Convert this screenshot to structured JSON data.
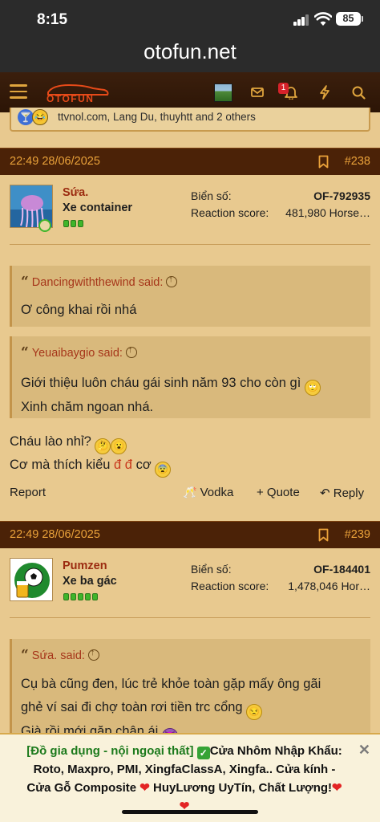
{
  "status": {
    "time": "8:15",
    "battery": "85"
  },
  "browser": {
    "url": "otofun.net"
  },
  "nav": {
    "logo_text": "OTOFUN",
    "notification_count": "1"
  },
  "reactions_strip": {
    "text": "ttvnol.com, Lang Du, thuyhtt and 2 others"
  },
  "posts": [
    {
      "datetime": "22:49 28/06/2025",
      "number": "#238",
      "username": "Sứa.",
      "user_title": "Xe container",
      "plate_label": "Biển số:",
      "plate_value": "OF-792935",
      "reaction_label": "Reaction score:",
      "reaction_value": "481,980 Horse…",
      "quotes": [
        {
          "author": "Dancingwiththewind said:",
          "body": "Ơ công khai rồi nhá"
        },
        {
          "author": "Yeuaibaygio said:",
          "body_line1": "Giới thiệu luôn cháu gái sinh năm 93 cho còn gì",
          "body_line2": "Xinh chăm ngoan nhá."
        }
      ],
      "text_line1": "Cháu lào nhỉ?",
      "text_line2_a": "Cơ mà thích kiểu",
      "text_line2_red": "đ đ",
      "text_line2_b": "cơ",
      "actions": {
        "report": "Report",
        "reaction": "Vodka",
        "quote": "+ Quote",
        "reply": "Reply"
      }
    },
    {
      "datetime": "22:49 28/06/2025",
      "number": "#239",
      "username": "Pumzen",
      "user_title": "Xe ba gác",
      "plate_label": "Biển số:",
      "plate_value": "OF-184401",
      "reaction_label": "Reaction score:",
      "reaction_value": "1,478,046 Hor…",
      "quotes": [
        {
          "author": "Sứa. said:",
          "body_line1": "Cụ bà cũng đen, lúc trẻ khỏe toàn gặp mấy ông gãi",
          "body_line2": "ghẻ ví sai đi chợ toàn rơi tiền trc cổng",
          "body_line3": "Già rồi mới gặp chân ái"
        }
      ]
    }
  ],
  "ad": {
    "tag": "[Đồ gia dụng - nội ngoại thất]",
    "line1": "Cửa Nhôm Nhập Khẩu:",
    "line2": "Roto, Maxpro, PMI, XingfaClassA, Xingfa.. Cửa kính -",
    "line3a": "Cửa Gỗ Composite",
    "line3b": "HuyLương UyTín, Chất Lượng!"
  },
  "colors": {
    "accent": "#eaa23a",
    "header_bg": "#4b2207",
    "page_bg": "#e8c98f",
    "username": "#9b2b10"
  }
}
